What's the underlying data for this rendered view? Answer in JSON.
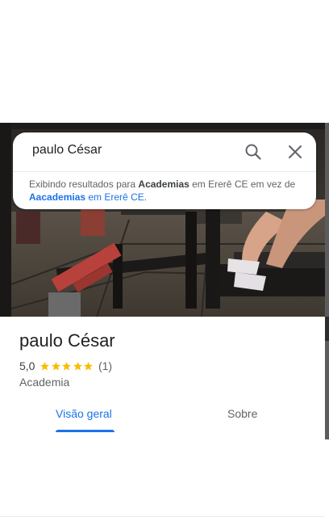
{
  "search": {
    "query": "paulo César"
  },
  "notice": {
    "prefix": "Exibindo resultados para ",
    "term": "Academias",
    "location": " em Ererê CE em vez de ",
    "alt_term": "Aacademias",
    "alt_location": " em Ererê CE."
  },
  "place": {
    "name": "paulo César",
    "rating": "5,0",
    "stars": 5,
    "review_count": "(1)",
    "category": "Academia"
  },
  "tabs": [
    {
      "label": "Visão geral",
      "selected": true
    },
    {
      "label": "Sobre",
      "selected": false
    }
  ],
  "colors": {
    "accent": "#1a73e8",
    "star": "#fbbc04",
    "text_primary": "#202124",
    "text_secondary": "#5f6368"
  },
  "icons": [
    "search-icon",
    "close-icon",
    "star-icon"
  ]
}
